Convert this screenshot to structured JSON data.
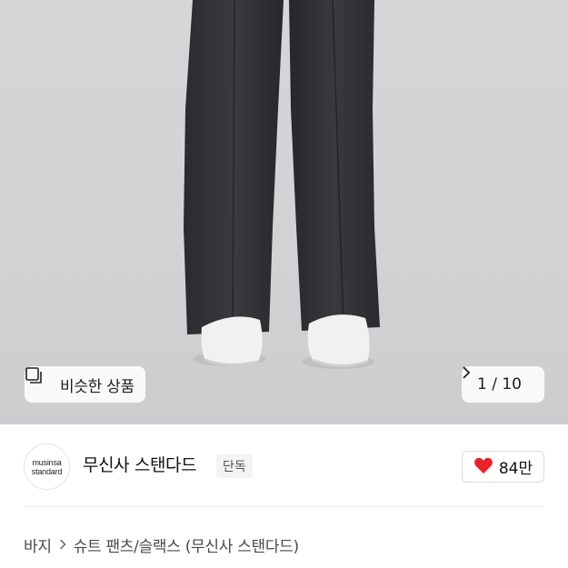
{
  "image": {
    "similar_button_label": "비슷한 상품",
    "counter_label": "1 / 10"
  },
  "brand": {
    "logo_line1": "musinsa",
    "logo_line2": "standard",
    "name": "무신사 스탠다드",
    "badge": "단독"
  },
  "like": {
    "count": "84만",
    "heart_color": "#e8222a"
  },
  "breadcrumb": {
    "category": "바지",
    "subcategory": "슈트 팬츠/슬랙스 (무신사 스탠다드)"
  },
  "icons": {
    "similar": "similar-products-icon",
    "next": "chevron-right-icon",
    "heart": "heart-icon",
    "breadcrumb_sep": "chevron-right-icon"
  }
}
